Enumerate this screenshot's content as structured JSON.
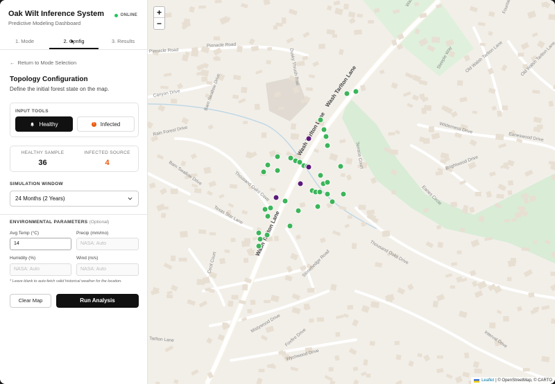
{
  "app": {
    "title": "Oak Wilt Inference System",
    "subtitle": "Predictive Modeling Dashboard",
    "status": "ONLINE"
  },
  "tabs": [
    {
      "label": "1. Mode"
    },
    {
      "label": "2. Config"
    },
    {
      "label": "3. Results"
    }
  ],
  "back_link": "Return to Mode Selection",
  "section": {
    "title": "Topology Configuration",
    "description": "Define the initial forest state on the map."
  },
  "input_tools": {
    "label": "INPUT TOOLS",
    "healthy_label": "Healthy",
    "infected_label": "Infected",
    "infected_icon": "!"
  },
  "stats": {
    "healthy_label": "HEALTHY SAMPLE",
    "healthy_value": "36",
    "infected_label": "INFECTED SOURCE",
    "infected_value": "4"
  },
  "simulation": {
    "label": "SIMULATION WINDOW",
    "selected": "24 Months (2 Years)"
  },
  "environment": {
    "label": "ENVIRONMENTAL PARAMETERS",
    "optional": "(Optional)",
    "avg_temp_label": "Avg Temp (°C)",
    "avg_temp_value": "14",
    "precip_label": "Precip (mm/mo)",
    "precip_placeholder": "NASA: Auto",
    "humidity_label": "Humidity (%)",
    "humidity_placeholder": "NASA: Auto",
    "wind_label": "Wind (m/s)",
    "wind_placeholder": "NASA: Auto",
    "note": "* Leave blank to auto-fetch valid historical weather for the location."
  },
  "actions": {
    "clear": "Clear Map",
    "run": "Run Analysis"
  },
  "map": {
    "zoom_in": "+",
    "zoom_out": "−",
    "attribution_leaflet": "Leaflet",
    "attribution_rest": "| © OpenStreetMap, © CARTO",
    "colors": {
      "healthy": "#3cb55a",
      "infected": "#5b1a7a",
      "park": "#d8ecd8",
      "road": "#ffffff"
    },
    "streets": [
      "Washington Road",
      "Pinnacle Road",
      "Pinnacle Road",
      "Dusky Thrush Trail",
      "Barn Swallow Drive",
      "Rain Forest Drive",
      "Barn Swallow Drive",
      "Canyon Drive",
      "Thousand Oaks Cove",
      "Texas Star Lane",
      "Wash Tarlton Lane",
      "Wash Tarlton Lane",
      "Wash Tarlton Lane",
      "Wilderness Drive",
      "Eaneswood Drive",
      "Brightwood Drive",
      "Eanes Circle",
      "Old Walsh Tarlton Lane",
      "Steeple Way",
      "Stonehedge Road",
      "Thousand Oaks Drive",
      "Mistywood Drive",
      "Foxfire Drive",
      "Wychwood Drive",
      "Interval Drive",
      "Tarlton Lane",
      "Cecil Court",
      "Terrace Court",
      "Old Walsh Tarlton Lane",
      "Fountainwood Drive"
    ],
    "healthy_count": 36,
    "infected_count": 4
  }
}
